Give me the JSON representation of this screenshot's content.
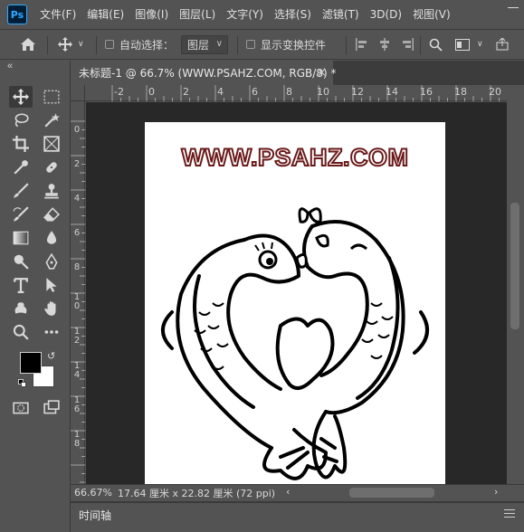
{
  "app": {
    "logo": "Ps"
  },
  "menu": [
    "文件(F)",
    "编辑(E)",
    "图像(I)",
    "图层(L)",
    "文字(Y)",
    "选择(S)",
    "滤镜(T)",
    "3D(D)",
    "视图(V)"
  ],
  "options": {
    "auto_select_label": "自动选择：",
    "layer_select_value": "图层",
    "show_transform_label": "显示变换控件"
  },
  "document": {
    "tab_title": "未标题-1 @ 66.7% (WWW.PSAHZ.COM, RGB/8) *",
    "watermark_text": "WWW.PSAHZ.COM"
  },
  "rulers": {
    "top": [
      "-2",
      "0",
      "2",
      "4",
      "6",
      "8",
      "10",
      "12",
      "14",
      "16",
      "18",
      "20"
    ],
    "left": [
      "0",
      "2",
      "4",
      "6",
      "8",
      "1 0",
      "1 2",
      "1 4",
      "1 6",
      "1 8"
    ]
  },
  "status": {
    "zoom": "66.67%",
    "doc_info": "17.64 厘米 x 22.82 厘米 (72 ppi)"
  },
  "timeline": {
    "label": "时间轴"
  },
  "colors": {
    "foreground": "#000000",
    "background": "#ffffff",
    "watermark_stroke": "#6b1a1a"
  }
}
